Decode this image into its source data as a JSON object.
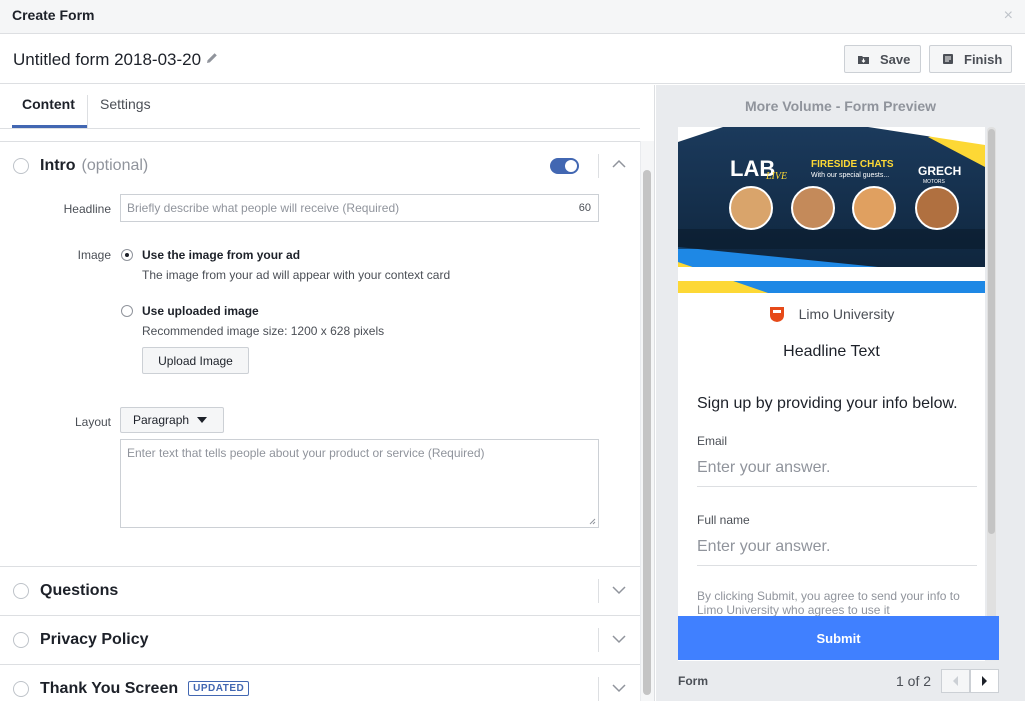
{
  "window": {
    "title": "Create Form",
    "close_glyph": "×"
  },
  "form": {
    "name": "Untitled form 2018-03-20",
    "edit_icon": "pencil-icon"
  },
  "toolbar": {
    "save_label": "Save",
    "finish_label": "Finish"
  },
  "tabs": [
    {
      "label": "Content",
      "active": true
    },
    {
      "label": "Settings",
      "active": false
    }
  ],
  "intro": {
    "title": "Intro",
    "optional": "(optional)",
    "enabled": true,
    "headline_label": "Headline",
    "headline_placeholder": "Briefly describe what people will receive (Required)",
    "headline_counter": "60",
    "image_label": "Image",
    "image_option_ad_title": "Use the image from your ad",
    "image_option_ad_sub": "The image from your ad will appear with your context card",
    "image_option_upload_title": "Use uploaded image",
    "image_option_upload_sub": "Recommended image size: 1200 x 628 pixels",
    "upload_button": "Upload Image",
    "layout_label": "Layout",
    "layout_value": "Paragraph",
    "body_placeholder": "Enter text that tells people about your product or service (Required)"
  },
  "sections": {
    "questions": "Questions",
    "privacy": "Privacy Policy",
    "thankyou": "Thank You Screen",
    "thankyou_badge": "UPDATED"
  },
  "preview": {
    "title": "More Volume - Form Preview",
    "banner": {
      "logo": "LAB",
      "logo_sub": "LIVE",
      "heading": "FIRESIDE CHATS",
      "subheading": "With our special guests...",
      "sponsor": "GRECH",
      "sponsor_sub": "MOTORS"
    },
    "brand_name": "Limo University",
    "headline": "Headline Text",
    "signup": "Sign up by providing your info below.",
    "fields": [
      {
        "label": "Email",
        "placeholder": "Enter your answer."
      },
      {
        "label": "Full name",
        "placeholder": "Enter your answer."
      }
    ],
    "disclaimer": "By clicking Submit, you agree to send your info to Limo University who agrees to use it",
    "submit": "Submit",
    "footer_label": "Form",
    "page_indicator": "1 of 2"
  },
  "colors": {
    "accent": "#4267b2",
    "submit_bg": "#4080ff",
    "panel_bg": "#e9ebee"
  }
}
